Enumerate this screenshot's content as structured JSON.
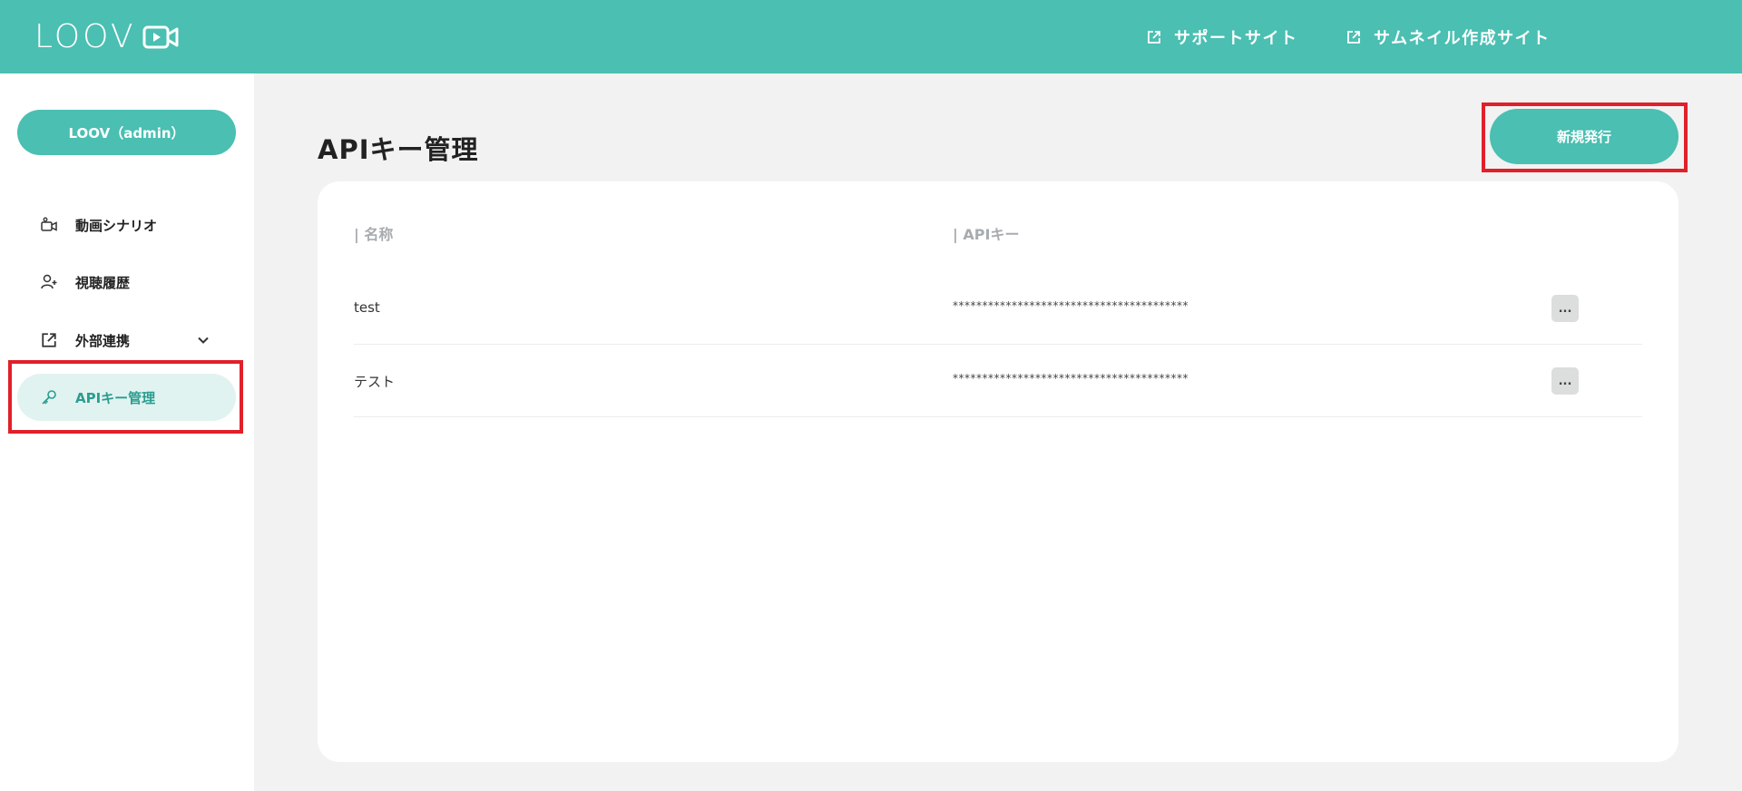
{
  "header": {
    "logo_text": "LOOV",
    "links": [
      {
        "label": "サポートサイト",
        "icon": "external-link-icon"
      },
      {
        "label": "サムネイル作成サイト",
        "icon": "external-link-icon"
      }
    ]
  },
  "sidebar": {
    "account_label": "LOOV（admin）",
    "items": [
      {
        "label": "動画シナリオ",
        "icon": "video-scenario-icon"
      },
      {
        "label": "視聴履歴",
        "icon": "user-add-icon"
      },
      {
        "label": "外部連携",
        "icon": "external-link-icon",
        "expandable": true
      },
      {
        "label": "APIキー管理",
        "icon": "key-icon",
        "active": true
      }
    ]
  },
  "main": {
    "title": "APIキー管理",
    "new_button_label": "新規発行",
    "table": {
      "columns": [
        "| 名称",
        "| APIキー"
      ],
      "rows": [
        {
          "name": "test",
          "key": "****************************************",
          "action": "..."
        },
        {
          "name": "テスト",
          "key": "****************************************",
          "action": "..."
        }
      ]
    }
  },
  "colors": {
    "brand": "#4abfb2",
    "active_bg": "#e1f3f0",
    "highlight": "#e0202a"
  }
}
